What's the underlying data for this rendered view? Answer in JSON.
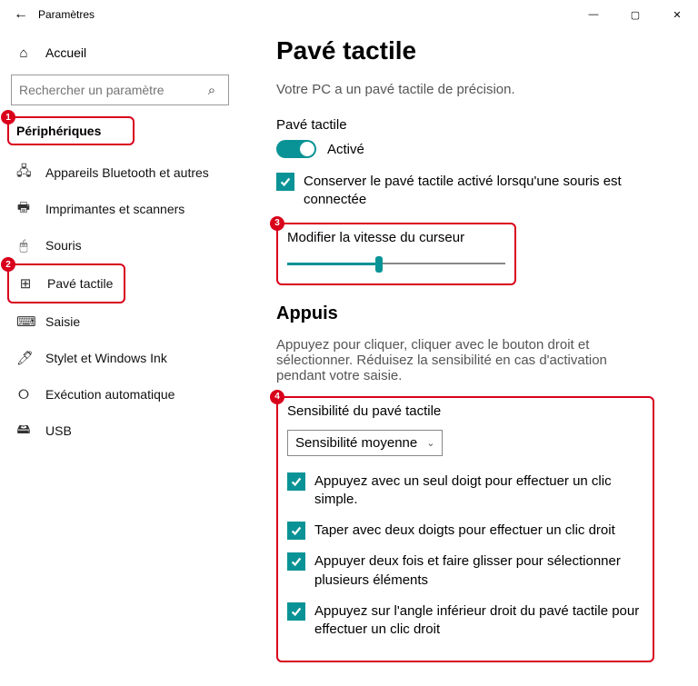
{
  "window": {
    "title": "Paramètres"
  },
  "sidebar": {
    "home": "Accueil",
    "search_placeholder": "Rechercher un paramètre",
    "section": "Périphériques",
    "items": [
      {
        "icon": "🖧",
        "label": "Appareils Bluetooth et autres"
      },
      {
        "icon": "🖶",
        "label": "Imprimantes et scanners"
      },
      {
        "icon": "🖱",
        "label": "Souris"
      },
      {
        "icon": "⊞",
        "label": "Pavé tactile"
      },
      {
        "icon": "⌨",
        "label": "Saisie"
      },
      {
        "icon": "🖊",
        "label": "Stylet et Windows Ink"
      },
      {
        "icon": "⭘",
        "label": "Exécution automatique"
      },
      {
        "icon": "🖴",
        "label": "USB"
      }
    ]
  },
  "main": {
    "title": "Pavé tactile",
    "precision_text": "Votre PC a un pavé tactile de précision.",
    "touchpad_label": "Pavé tactile",
    "toggle_state": "Activé",
    "keep_active_label": "Conserver le pavé tactile activé lorsqu'une souris est connectée",
    "cursor_speed_label": "Modifier la vitesse du curseur",
    "cursor_speed_value": 42,
    "taps_heading": "Appuis",
    "taps_desc": "Appuyez pour cliquer, cliquer avec le bouton droit et sélectionner. Réduisez la sensibilité en cas d'activation pendant votre saisie.",
    "sensitivity_label": "Sensibilité du pavé tactile",
    "sensitivity_value": "Sensibilité moyenne",
    "checks": [
      "Appuyez avec un seul doigt pour effectuer un clic simple.",
      "Taper avec deux doigts pour effectuer un clic droit",
      "Appuyer deux fois et faire glisser pour sélectionner plusieurs éléments",
      "Appuyez sur l'angle inférieur droit du pavé tactile pour effectuer un clic droit"
    ]
  },
  "callouts": {
    "c1": "1",
    "c2": "2",
    "c3": "3",
    "c4": "4"
  }
}
